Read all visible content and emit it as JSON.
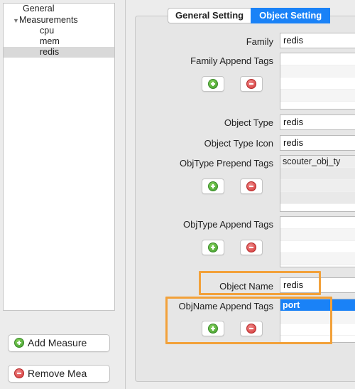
{
  "tree": {
    "items": [
      {
        "label": "General"
      },
      {
        "label": "Measurements"
      },
      {
        "label": "cpu"
      },
      {
        "label": "mem"
      },
      {
        "label": "redis"
      }
    ]
  },
  "sidebar_buttons": {
    "add_label": "Add Measure",
    "remove_label": "Remove Mea"
  },
  "tabs": [
    {
      "label": "General Setting"
    },
    {
      "label": "Object Setting"
    }
  ],
  "form": {
    "family": {
      "label": "Family",
      "value": "redis"
    },
    "family_append_tags": {
      "label": "Family Append Tags",
      "items": []
    },
    "object_type": {
      "label": "Object Type",
      "value": "redis"
    },
    "object_type_icon": {
      "label": "Object Type Icon",
      "value": "redis"
    },
    "objtype_prepend_tags": {
      "label": "ObjType Prepend Tags",
      "items": [
        "scouter_obj_ty"
      ]
    },
    "objtype_append_tags": {
      "label": "ObjType Append Tags",
      "items": []
    },
    "object_name": {
      "label": "Object Name",
      "value": "redis"
    },
    "objname_append_tags": {
      "label": "ObjName Append Tags",
      "items": [
        "port"
      ]
    }
  },
  "colors": {
    "accent": "#1a82f7",
    "highlight": "#f2a13a",
    "add_green": "#3c9a2a",
    "remove_red": "#d33434"
  },
  "icons": {
    "add": "plus-circle-icon",
    "remove": "minus-circle-icon",
    "expand": "triangle-down-icon"
  }
}
